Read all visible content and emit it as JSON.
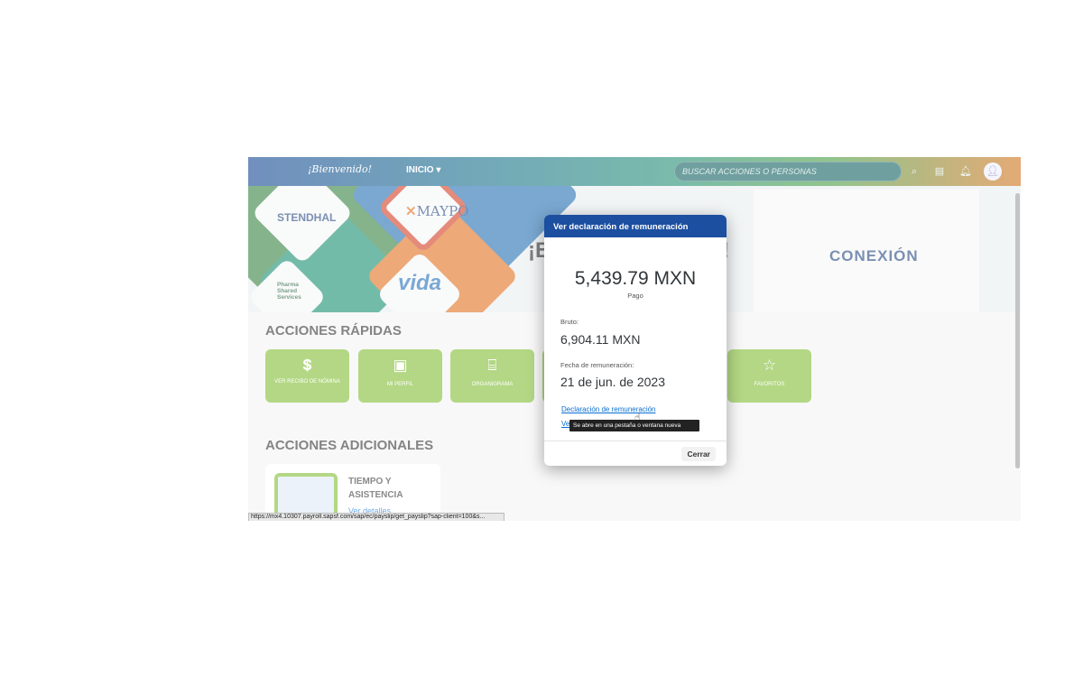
{
  "header": {
    "welcome": "¡Bienvenido!",
    "nav_label": "INICIO",
    "search_placeholder": "BUSCAR ACCIONES O PERSONAS"
  },
  "banner": {
    "brands": [
      "STENDHAL",
      "MAYPO",
      "Pharma Shared Services",
      "vida",
      "CONEXIÓN"
    ],
    "greeting_partial": "¡B"
  },
  "quick_actions": {
    "title": "ACCIONES RÁPIDAS",
    "items": [
      {
        "label": "VER RECIBO DE NÓMINA",
        "icon": "dollar-receipt-icon"
      },
      {
        "label": "MI PERFIL",
        "icon": "id-card-icon"
      },
      {
        "label": "ORGANIGRAMA",
        "icon": "org-chart-icon"
      },
      {
        "label": "FAVORITOS",
        "icon": "star-icon"
      }
    ]
  },
  "additional_actions": {
    "title": "ACCIONES ADICIONALES",
    "card_title": "TIEMPO Y ASISTENCIA",
    "card_link": "Ver detalles"
  },
  "status_url": "https://mx4.10307.payroll.sapsf.com/sap/ec/payslip/get_payslip?sap-client=100&s...",
  "dialog": {
    "title": "Ver declaración de remuneración",
    "amount": "5,439.79 MXN",
    "amount_label": "Pago",
    "gross_label": "Bruto:",
    "gross_value": "6,904.11 MXN",
    "date_label": "Fecha de remuneración:",
    "date_value": "21 de jun. de 2023",
    "link_statement": "Declaración de remuneración",
    "link_second_partial": "Ve",
    "tooltip": "Se abre en una pestaña o ventana nueva",
    "close_button": "Cerrar"
  }
}
